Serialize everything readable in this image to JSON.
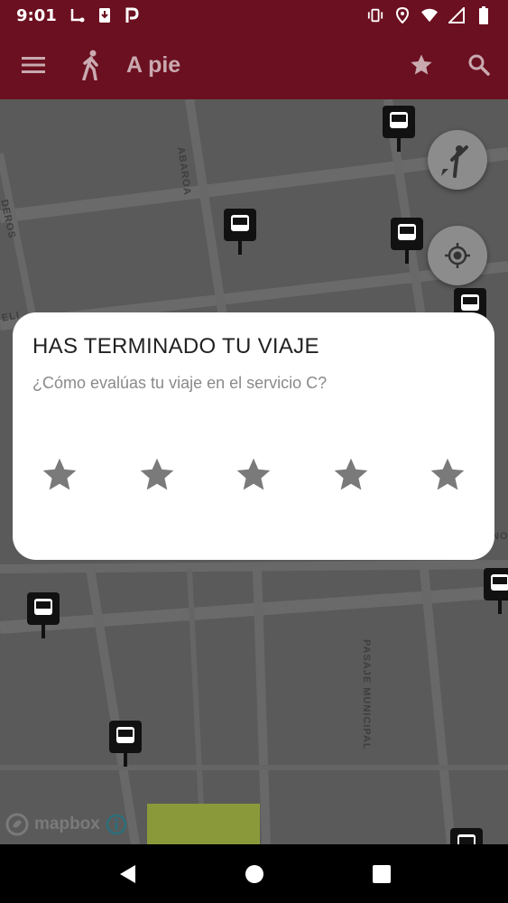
{
  "status_bar": {
    "time": "9:01"
  },
  "app_bar": {
    "title": "A pie",
    "menu_icon": "menu-icon",
    "walk_icon": "walk-icon",
    "favorite_icon": "star-icon",
    "search_icon": "search-icon"
  },
  "map": {
    "streets": [
      "ABAROA",
      "DEROS",
      "ELI",
      "PASAJE MUNICIPAL",
      "NO"
    ],
    "attribution": "mapbox",
    "colors": {
      "background": "#5a5a5a",
      "road": "#6e6e6e",
      "park": "#8a9a3a"
    }
  },
  "dialog": {
    "title": "HAS TERMINADO TU VIAJE",
    "message": "¿Cómo evalúas tu viaje en el servicio C?",
    "stars": [
      {
        "label": "1 estrella"
      },
      {
        "label": "2 estrellas"
      },
      {
        "label": "3 estrellas"
      },
      {
        "label": "4 estrellas"
      },
      {
        "label": "5 estrellas"
      }
    ]
  },
  "colors": {
    "primary": "#6b1020",
    "star": "#7a7a7a"
  }
}
